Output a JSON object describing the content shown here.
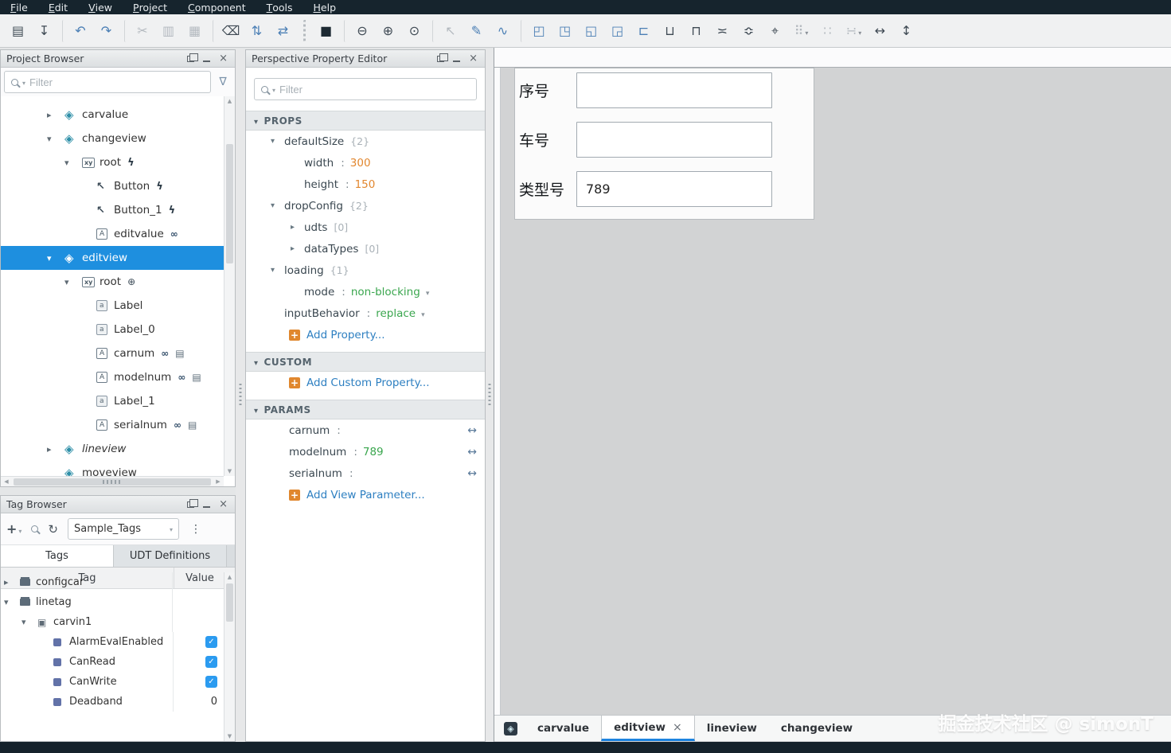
{
  "menubar": {
    "items": [
      {
        "key": "F",
        "rest": "ile"
      },
      {
        "key": "E",
        "rest": "dit"
      },
      {
        "key": "V",
        "rest": "iew"
      },
      {
        "key": "P",
        "rest": "roject"
      },
      {
        "key": "C",
        "rest": "omponent"
      },
      {
        "key": "T",
        "rest": "ools"
      },
      {
        "key": "H",
        "rest": "elp"
      }
    ]
  },
  "toolbar": {
    "icons": [
      {
        "name": "save",
        "glyph": "▤",
        "cls": "c-dark"
      },
      {
        "name": "save-import",
        "glyph": "↧",
        "cls": "c-dark"
      },
      {
        "name": "undo",
        "glyph": "↶",
        "cls": "c-blue gs"
      },
      {
        "name": "redo",
        "glyph": "↷",
        "cls": "c-blue"
      },
      {
        "name": "cut",
        "glyph": "✂",
        "cls": "c-gray gs"
      },
      {
        "name": "copy",
        "glyph": "▥",
        "cls": "c-gray"
      },
      {
        "name": "paste",
        "glyph": "▦",
        "cls": "c-gray"
      },
      {
        "name": "delete",
        "glyph": "⌫",
        "cls": "c-dark gs"
      },
      {
        "name": "sort",
        "glyph": "⇅",
        "cls": "c-blue"
      },
      {
        "name": "compare",
        "glyph": "⇄",
        "cls": "c-blue"
      },
      {
        "name": "stop",
        "glyph": "■",
        "cls": "c-black grip-l"
      },
      {
        "name": "zoom-out",
        "glyph": "⊖",
        "cls": "c-dark gs"
      },
      {
        "name": "zoom-in",
        "glyph": "⊕",
        "cls": "c-dark"
      },
      {
        "name": "zoom-reset",
        "glyph": "⊙",
        "cls": "c-dark"
      },
      {
        "name": "select-tool",
        "glyph": "↖",
        "cls": "c-gray gs"
      },
      {
        "name": "pen-tool",
        "glyph": "✎",
        "cls": "c-blue"
      },
      {
        "name": "node-tool",
        "glyph": "∿",
        "cls": "c-blue"
      },
      {
        "name": "bring-to-front",
        "glyph": "◰",
        "cls": "c-blue gs"
      },
      {
        "name": "bring-forward",
        "glyph": "◳",
        "cls": "c-blue"
      },
      {
        "name": "send-backward",
        "glyph": "◱",
        "cls": "c-blue"
      },
      {
        "name": "send-to-back",
        "glyph": "◲",
        "cls": "c-blue"
      },
      {
        "name": "align-left",
        "glyph": "⊏",
        "cls": "c-blue"
      },
      {
        "name": "align-bottom",
        "glyph": "⊔",
        "cls": "c-dark"
      },
      {
        "name": "align-top",
        "glyph": "⊓",
        "cls": "c-dark"
      },
      {
        "name": "distribute-horizontal",
        "glyph": "≍",
        "cls": "c-dark"
      },
      {
        "name": "distribute-vertical",
        "glyph": "≎",
        "cls": "c-dark"
      },
      {
        "name": "position",
        "glyph": "⌖",
        "cls": "c-dark"
      },
      {
        "name": "layout-options",
        "glyph": "⠿",
        "cls": "c-gray",
        "caret": true
      },
      {
        "name": "spacing",
        "glyph": "∷",
        "cls": "c-gray"
      },
      {
        "name": "size-options",
        "glyph": "∺",
        "cls": "c-gray",
        "caret": true
      },
      {
        "name": "match-width",
        "glyph": "↔",
        "cls": "c-dark"
      },
      {
        "name": "match-height",
        "glyph": "↕",
        "cls": "c-dark"
      }
    ]
  },
  "project_browser": {
    "title": "Project Browser",
    "filter_placeholder": "Filter",
    "tree": [
      {
        "label": "carvalue",
        "cls": "d1",
        "arrow": "right",
        "icon": "view"
      },
      {
        "label": "changeview",
        "cls": "d1",
        "arrow": "down",
        "icon": "view"
      },
      {
        "label": "root",
        "cls": "d2",
        "arrow": "down",
        "icon": "container",
        "bolt": true
      },
      {
        "label": "Button",
        "cls": "d3",
        "icon": "button",
        "bolt": true
      },
      {
        "label": "Button_1",
        "cls": "d3",
        "icon": "button",
        "bolt": true
      },
      {
        "label": "editvalue",
        "cls": "d3",
        "icon": "textfield",
        "link": true
      },
      {
        "label": "editview",
        "cls": "d1 sel",
        "arrow": "down",
        "icon": "view"
      },
      {
        "label": "root",
        "cls": "d2",
        "arrow": "down",
        "icon": "container",
        "pos": true
      },
      {
        "label": "Label",
        "cls": "d3",
        "icon": "label"
      },
      {
        "label": "Label_0",
        "cls": "d3",
        "icon": "label"
      },
      {
        "label": "carnum",
        "cls": "d3",
        "icon": "textfield",
        "link": true,
        "script": true
      },
      {
        "label": "modelnum",
        "cls": "d3",
        "icon": "textfield",
        "link": true,
        "script": true
      },
      {
        "label": "Label_1",
        "cls": "d3",
        "icon": "label"
      },
      {
        "label": "serialnum",
        "cls": "d3",
        "icon": "textfield",
        "link": true,
        "script": true
      },
      {
        "label": "lineview",
        "cls": "d1 italic",
        "arrow": "right",
        "icon": "view"
      },
      {
        "label": "moveview",
        "cls": "d1",
        "icon": "view"
      }
    ]
  },
  "property_editor": {
    "title": "Perspective Property Editor",
    "filter_placeholder": "Filter",
    "sections": {
      "props": "PROPS",
      "custom": "CUSTOM",
      "params": "PARAMS"
    },
    "props_rows": [
      {
        "name": "defaultSize",
        "badge": "{2}",
        "arrow": "down",
        "cls": "i1"
      },
      {
        "name": "width",
        "colon": ":",
        "value": "300",
        "vcls": "num",
        "cls": "i2"
      },
      {
        "name": "height",
        "colon": ":",
        "value": "150",
        "vcls": "num",
        "cls": "i2"
      },
      {
        "name": "dropConfig",
        "badge": "{2}",
        "arrow": "down",
        "cls": "i1"
      },
      {
        "name": "udts",
        "badge": "[0]",
        "arrow": "right",
        "cls": "i2"
      },
      {
        "name": "dataTypes",
        "badge": "[0]",
        "arrow": "right",
        "cls": "i2"
      },
      {
        "name": "loading",
        "badge": "{1}",
        "arrow": "down",
        "cls": "i1"
      },
      {
        "name": "mode",
        "colon": ":",
        "value": "non-blocking",
        "vcls": "enum",
        "caret": true,
        "cls": "i2"
      },
      {
        "name": "inputBehavior",
        "colon": ":",
        "value": "replace",
        "vcls": "enum",
        "caret": true,
        "cls": "i1"
      }
    ],
    "add_property": "Add Property...",
    "add_custom": "Add Custom Property...",
    "params_rows": [
      {
        "name": "carnum",
        "colon": ":",
        "bidir": true
      },
      {
        "name": "modelnum",
        "colon": ":",
        "value": "789",
        "vcls": "enum",
        "bidir": true
      },
      {
        "name": "serialnum",
        "colon": ":",
        "bidir": true
      }
    ],
    "add_param": "Add View Parameter..."
  },
  "tag_browser": {
    "title": "Tag Browser",
    "provider": "Sample_Tags",
    "tabs": [
      {
        "label": "Tags",
        "cls": "active"
      },
      {
        "label": "UDT Definitions",
        "cls": ""
      }
    ],
    "columns": {
      "tag": "Tag",
      "value": "Value"
    },
    "rows": [
      {
        "label": "configcar",
        "cls": "t1",
        "arrow": "right",
        "icon": "folder"
      },
      {
        "label": "linetag",
        "cls": "t1",
        "arrow": "down",
        "icon": "folder"
      },
      {
        "label": "carvin1",
        "cls": "t2",
        "arrow": "down",
        "icon": "device"
      },
      {
        "label": "AlarmEvalEnabled",
        "cls": "t3",
        "icon": "tag",
        "check": true
      },
      {
        "label": "CanRead",
        "cls": "t3",
        "icon": "tag",
        "check": true
      },
      {
        "label": "CanWrite",
        "cls": "t3",
        "icon": "tag",
        "check": true
      },
      {
        "label": "Deadband",
        "cls": "t3",
        "icon": "tag",
        "value": "0"
      }
    ]
  },
  "canvas": {
    "form_rows": [
      {
        "label": "序号",
        "value": ""
      },
      {
        "label": "车号",
        "value": ""
      },
      {
        "label": "类型号",
        "value": "789"
      }
    ]
  },
  "view_tabs": {
    "tabs": [
      {
        "label": "carvalue",
        "cls": ""
      },
      {
        "label": "editview",
        "cls": "active",
        "closable": true
      },
      {
        "label": "lineview",
        "cls": ""
      },
      {
        "label": "changeview",
        "cls": ""
      }
    ]
  },
  "watermark": "掘金技术社区 @ simonT",
  "colors": {
    "selection_blue": "#1e8fdf",
    "menubar_dark": "#16242d",
    "value_number_orange": "#e2872f",
    "value_enum_green": "#3aa64e",
    "link_blue": "#2d7fc1",
    "checkbox_blue": "#2b9bf0",
    "add_plus_orange": "#e0872e",
    "active_tab_accent": "#1d84e0"
  }
}
